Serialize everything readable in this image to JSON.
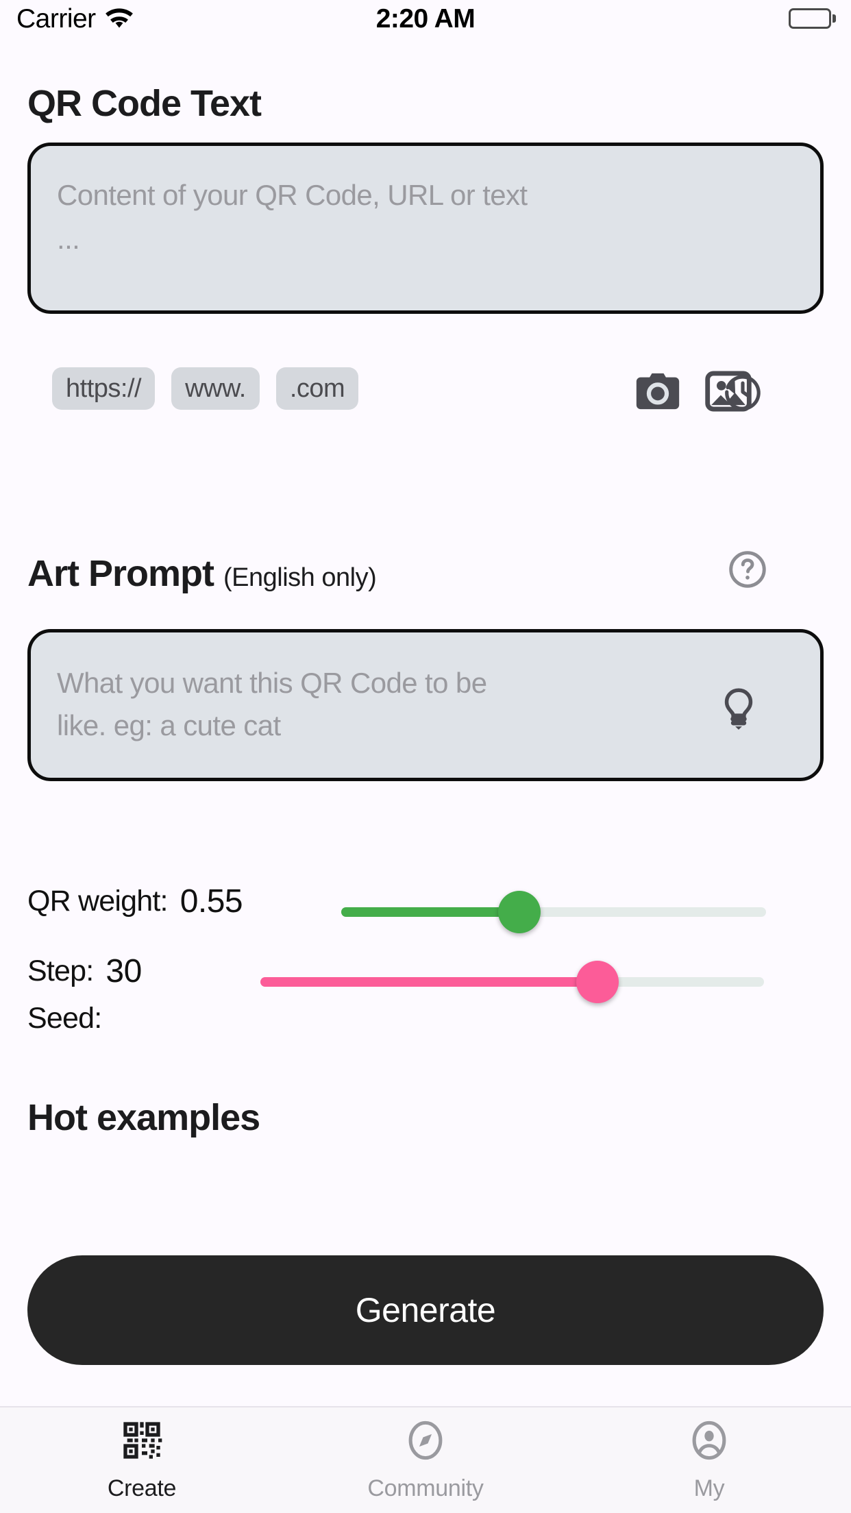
{
  "status_bar": {
    "carrier": "Carrier",
    "time": "2:20 AM",
    "wifi_icon": "wifi-icon",
    "battery_icon": "battery-full-icon"
  },
  "qr_section": {
    "title": "QR Code Text",
    "input_placeholder_line1": "Content of your QR Code, URL or text",
    "input_placeholder_line2": "...",
    "input_value": "",
    "history_icon": "history-icon",
    "chips": [
      "https://",
      "www.",
      ".com"
    ],
    "camera_icon": "camera-icon",
    "gallery_icon": "image-icon"
  },
  "art_section": {
    "title": "Art Prompt",
    "subtitle": "(English only)",
    "help_icon": "help-circle-icon",
    "input_placeholder_line1": "What you want this QR Code to be",
    "input_placeholder_line2": "like. eg: a cute cat",
    "input_value": "",
    "idea_icon": "lightbulb-icon"
  },
  "controls": {
    "qr_weight": {
      "label": "QR weight:",
      "value": "0.55",
      "percent": 42,
      "color": "#44ad4a"
    },
    "step": {
      "label": "Step:",
      "value": "30",
      "percent": 67,
      "color": "#fc5c98"
    },
    "seed": {
      "label": "Seed:",
      "value": ""
    }
  },
  "hot_examples": {
    "title": "Hot examples"
  },
  "generate_button": {
    "label": "Generate"
  },
  "tabbar": {
    "tabs": [
      {
        "label": "Create",
        "icon": "qr-code-icon",
        "active": true
      },
      {
        "label": "Community",
        "icon": "compass-icon",
        "active": false
      },
      {
        "label": "My",
        "icon": "person-circle-icon",
        "active": false
      }
    ]
  }
}
